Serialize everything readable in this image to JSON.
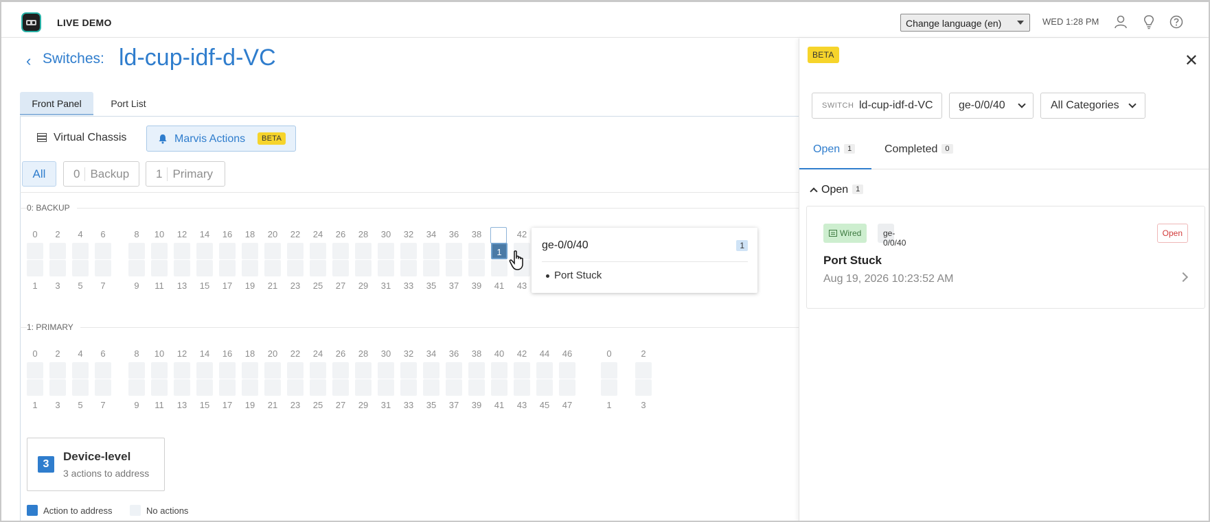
{
  "topbar": {
    "brand": "LIVE DEMO",
    "language_select": "Change language (en)",
    "clock": "WED 1:28 PM",
    "icons": [
      "user-icon",
      "lightbulb-icon",
      "help-icon"
    ]
  },
  "header": {
    "breadcrumb": "Switches:",
    "title": "ld-cup-idf-d-VC"
  },
  "tabs": [
    "Front Panel",
    "Port List"
  ],
  "panel": {
    "virtual_chassis": "Virtual Chassis",
    "marvis_actions": "Marvis Actions",
    "beta": "BETA",
    "filters": {
      "all": "All",
      "backup_count": "0",
      "backup": "Backup",
      "primary_count": "1",
      "primary": "Primary"
    },
    "sections": [
      "0: BACKUP",
      "1: PRIMARY"
    ],
    "top_ports": [
      "0",
      "2",
      "4",
      "6",
      "8",
      "10",
      "12",
      "14",
      "16",
      "18",
      "20",
      "22",
      "24",
      "26",
      "28",
      "30",
      "32",
      "34",
      "36",
      "38",
      "40",
      "42",
      "44",
      "46"
    ],
    "bottom_ports": [
      "1",
      "3",
      "5",
      "7",
      "9",
      "11",
      "13",
      "15",
      "17",
      "19",
      "21",
      "23",
      "25",
      "27",
      "29",
      "31",
      "33",
      "35",
      "37",
      "39",
      "41",
      "43",
      "45",
      "47"
    ],
    "uplink_top": [
      "0",
      "2"
    ],
    "uplink_bottom": [
      "1",
      "3"
    ],
    "action_port_count": "1",
    "device_level": {
      "count": "3",
      "title": "Device-level",
      "subtitle": "3 actions to address"
    },
    "legend": {
      "action": "Action to address",
      "none": "No actions",
      "action_color": "#2f7dcd",
      "none_color": "#eef2f6"
    }
  },
  "tooltip": {
    "port": "ge-0/0/40",
    "count": "1",
    "item": "Port Stuck"
  },
  "drawer": {
    "beta": "BETA",
    "switch_label": "SWITCH",
    "switch_value": "ld-cup-idf-d-VC",
    "port_select": "ge-0/0/40",
    "category_select": "All Categories",
    "tab_open": "Open",
    "tab_open_count": "1",
    "tab_completed": "Completed",
    "tab_completed_count": "0",
    "group_title": "Open",
    "group_count": "1",
    "card": {
      "tag_wired": "Wired",
      "tag_port": "ge-0/0/40",
      "status": "Open",
      "title": "Port Stuck",
      "date": "Aug 19, 2026 10:23:52 AM"
    }
  },
  "colors": {
    "accent": "#2f7dcd",
    "beta": "#f6d42b",
    "status_open": "#d23a3a",
    "wired": "#3d7a40"
  }
}
